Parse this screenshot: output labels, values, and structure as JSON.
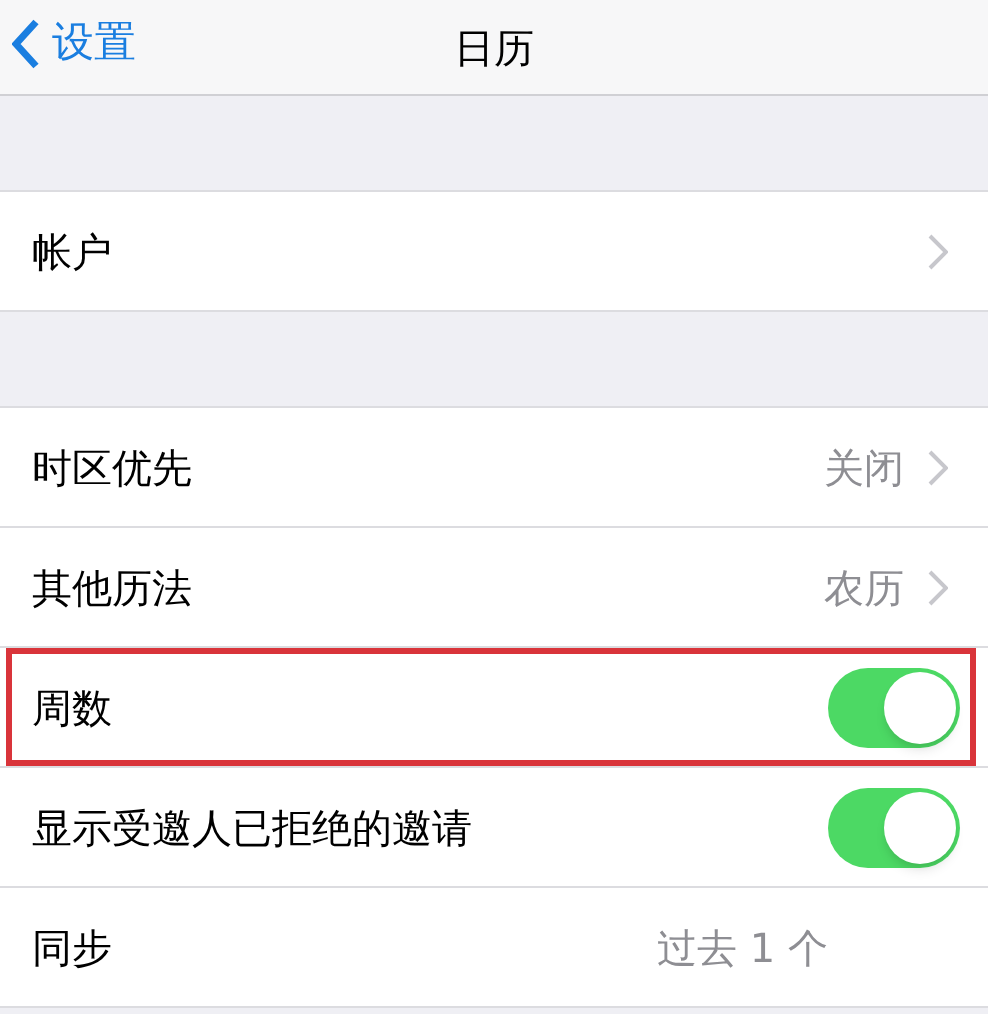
{
  "nav": {
    "back": "设置",
    "title": "日历"
  },
  "sections": [
    {
      "rows": [
        {
          "kind": "link",
          "label": "帐户",
          "chevron": true,
          "highlighted": false
        }
      ]
    },
    {
      "rows": [
        {
          "kind": "link",
          "label": "时区优先",
          "value": "关闭",
          "chevron": true,
          "highlighted": false
        },
        {
          "kind": "link",
          "label": "其他历法",
          "value": "农历",
          "chevron": true,
          "highlighted": false
        },
        {
          "kind": "toggle",
          "label": "周数",
          "on": true,
          "highlighted": true
        },
        {
          "kind": "toggle",
          "label": "显示受邀人已拒绝的邀请",
          "on": true,
          "highlighted": false
        },
        {
          "kind": "link",
          "label": "同步",
          "value": "过去 1 个",
          "chevron": false,
          "highlighted": false
        }
      ]
    }
  ]
}
